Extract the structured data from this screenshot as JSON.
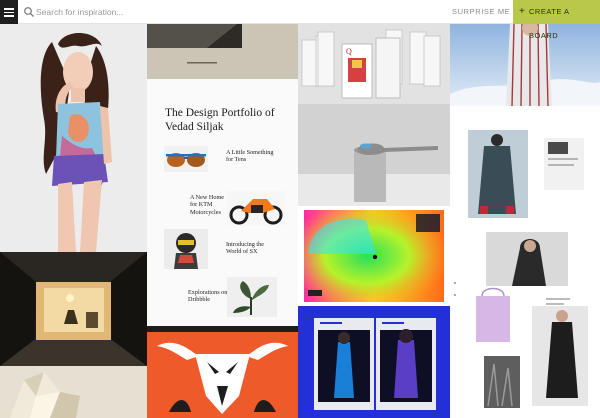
{
  "header": {
    "menu_icon": "hamburger-menu-icon",
    "search_icon": "search-icon",
    "search_placeholder": "Search for inspiration...",
    "surprise_label": "SURPRISE ME",
    "create_board_plus": "+",
    "create_board_label": "CREATE A BOARD",
    "accent_color": "#b9c84a"
  },
  "portfolio": {
    "title": "The Design Portfolio of Vedad Siljak",
    "items": [
      {
        "label": "A Little Something for Tens"
      },
      {
        "label": "A New Home for KTM Motorcycles"
      },
      {
        "label": "Introducing the World of SX"
      },
      {
        "label": "Explorations on Dribbble"
      }
    ]
  }
}
